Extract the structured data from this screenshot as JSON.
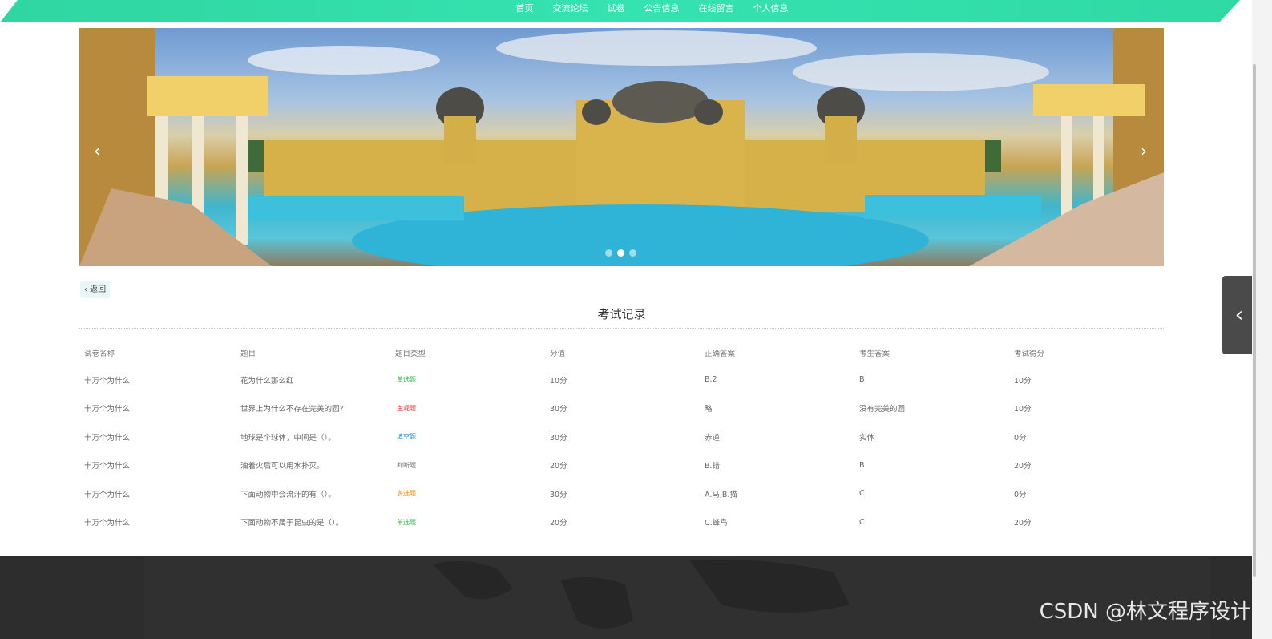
{
  "nav": {
    "items": [
      "首页",
      "交流论坛",
      "试卷",
      "公告信息",
      "在线留言",
      "个人信息"
    ]
  },
  "banner": {
    "prev_icon": "chevron-left-icon",
    "next_icon": "chevron-right-icon",
    "slide_count": 3,
    "active_slide": 2
  },
  "back": {
    "label": "‹ 返回"
  },
  "page_title": "考试记录",
  "table": {
    "headers": [
      "试卷名称",
      "题目",
      "题目类型",
      "分值",
      "正确答案",
      "考生答案",
      "考试得分"
    ],
    "rows": [
      {
        "paper": "十万个为什么",
        "question": "花为什么那么红",
        "type": "单选题",
        "type_color": "#2db84b",
        "score": "10分",
        "correct": "B.2",
        "answer": "B",
        "got": "10分"
      },
      {
        "paper": "十万个为什么",
        "question": "世界上为什么不存在完美的圆?",
        "type": "主观题",
        "type_color": "#e53935",
        "score": "30分",
        "correct": "略",
        "answer": "没有完美的圆",
        "got": "10分"
      },
      {
        "paper": "十万个为什么",
        "question": "地球是个球体，中间是（）。",
        "type": "填空题",
        "type_color": "#1e88e5",
        "score": "30分",
        "correct": "赤道",
        "answer": "实体",
        "got": "0分"
      },
      {
        "paper": "十万个为什么",
        "question": "油着火后可以用水扑灭。",
        "type": "判断题",
        "type_color": "#757575",
        "score": "20分",
        "correct": "B.错",
        "answer": "B",
        "got": "20分"
      },
      {
        "paper": "十万个为什么",
        "question": "下面动物中会流汗的有（）。",
        "type": "多选题",
        "type_color": "#ef8c00",
        "score": "30分",
        "correct": "A.马,B.猫",
        "answer": "C",
        "got": "0分"
      },
      {
        "paper": "十万个为什么",
        "question": "下面动物不属于昆虫的是（）。",
        "type": "单选题",
        "type_color": "#2db84b",
        "score": "20分",
        "correct": "C.蜂鸟",
        "answer": "C",
        "got": "20分"
      }
    ]
  },
  "side_toggle": {
    "icon": "chevron-left-icon",
    "glyph": "‹"
  },
  "watermark": "CSDN @林文程序设计"
}
